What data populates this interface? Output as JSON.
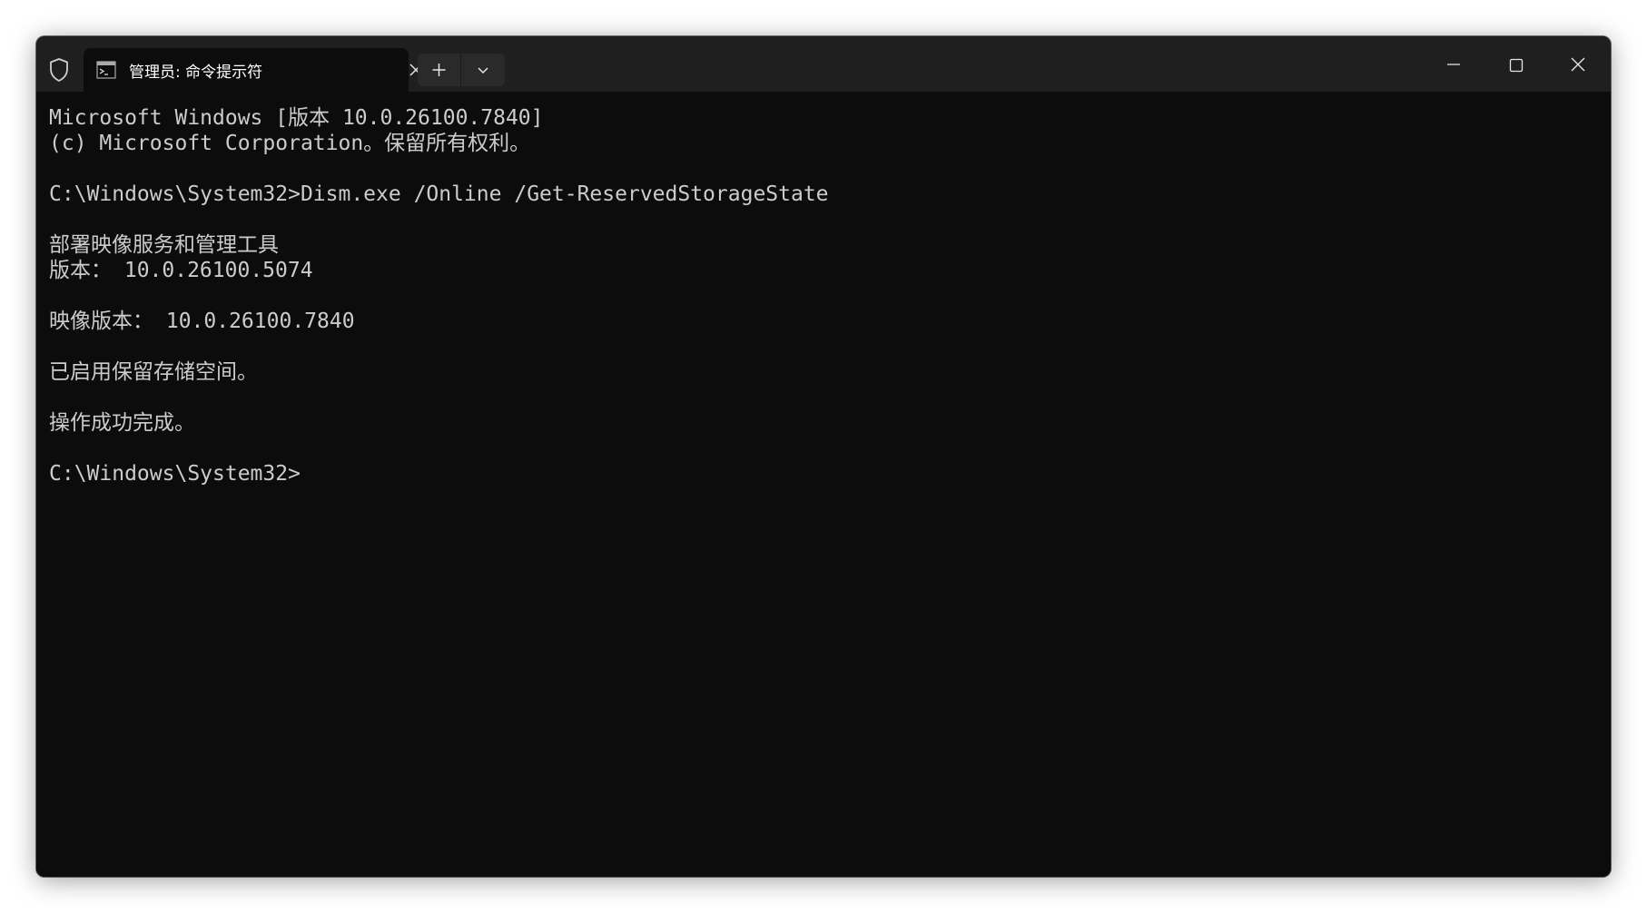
{
  "titlebar": {
    "tab_title": "管理员: 命令提示符",
    "shield_icon": "shield-icon",
    "tab_icon": "console-icon",
    "tab_close_icon": "close-icon",
    "new_tab_icon": "plus-icon",
    "dropdown_icon": "chevron-down-icon",
    "minimize_icon": "minimize-icon",
    "maximize_icon": "maximize-icon",
    "close_icon": "close-icon"
  },
  "console": {
    "lines": [
      "Microsoft Windows [版本 10.0.26100.7840]",
      "(c) Microsoft Corporation。保留所有权利。",
      "",
      "C:\\Windows\\System32>Dism.exe /Online /Get-ReservedStorageState",
      "",
      "部署映像服务和管理工具",
      "版本： 10.0.26100.5074",
      "",
      "映像版本： 10.0.26100.7840",
      "",
      "已启用保留存储空间。",
      "",
      "操作成功完成。",
      "",
      "C:\\Windows\\System32>"
    ]
  },
  "colors": {
    "console_background": "#0c0c0c",
    "console_text": "#cccccc",
    "titlebar_background": "#1f1f1f"
  }
}
